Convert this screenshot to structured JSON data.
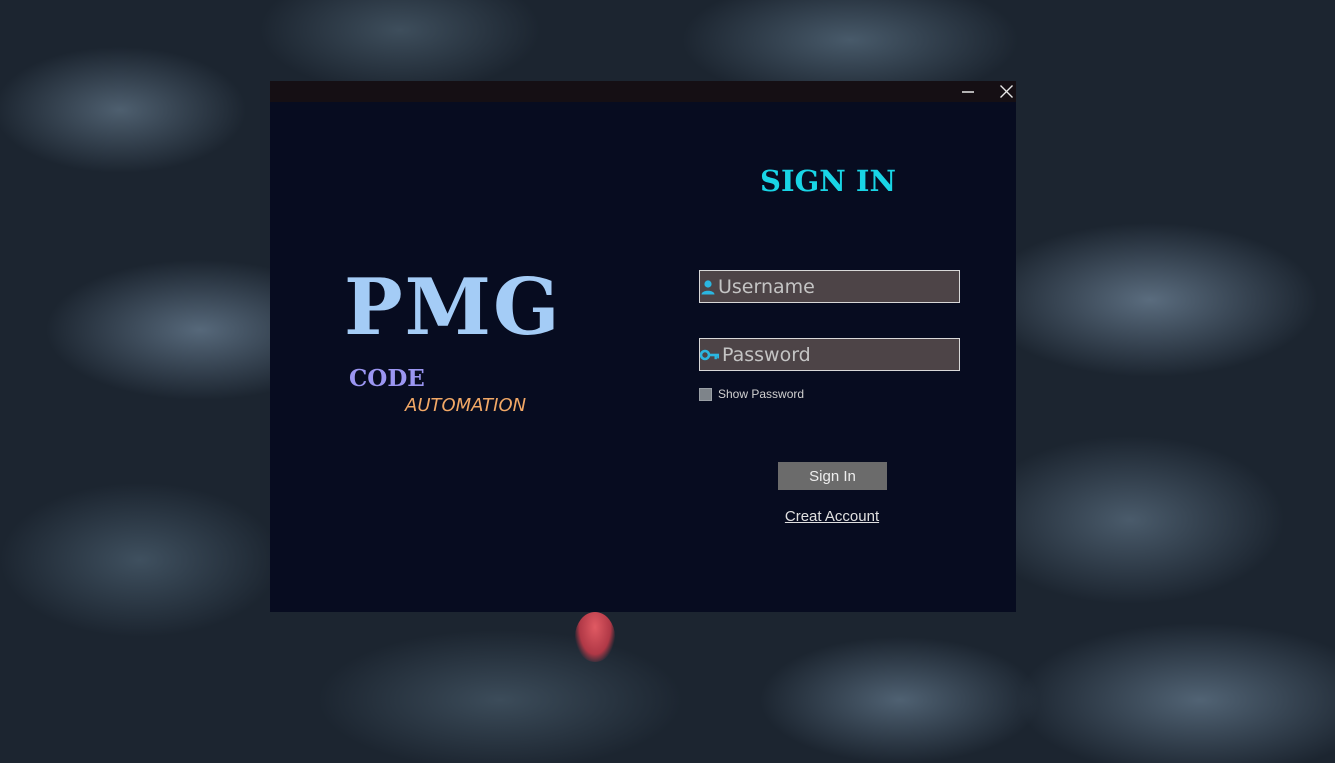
{
  "window": {
    "minimize_glyph": "—",
    "close_glyph": "✕"
  },
  "logo": {
    "main": "PMG",
    "line1": "CODE",
    "line2": "AUTOMATION"
  },
  "form": {
    "title": "SIGN IN",
    "username_placeholder": "Username",
    "password_placeholder": "Password",
    "show_password_label": "Show Password",
    "show_password_checked": false,
    "signin_label": "Sign In",
    "create_account_label": "Creat Account"
  },
  "icons": {
    "username": "user-icon",
    "password": "key-icon"
  },
  "colors": {
    "window_bg": "#070c20",
    "title_accent": "#19d5e6",
    "logo_main": "#a4ccf6",
    "logo_code": "#9b96f2",
    "logo_automation": "#f2a866",
    "icon_accent": "#2bb6e0"
  }
}
